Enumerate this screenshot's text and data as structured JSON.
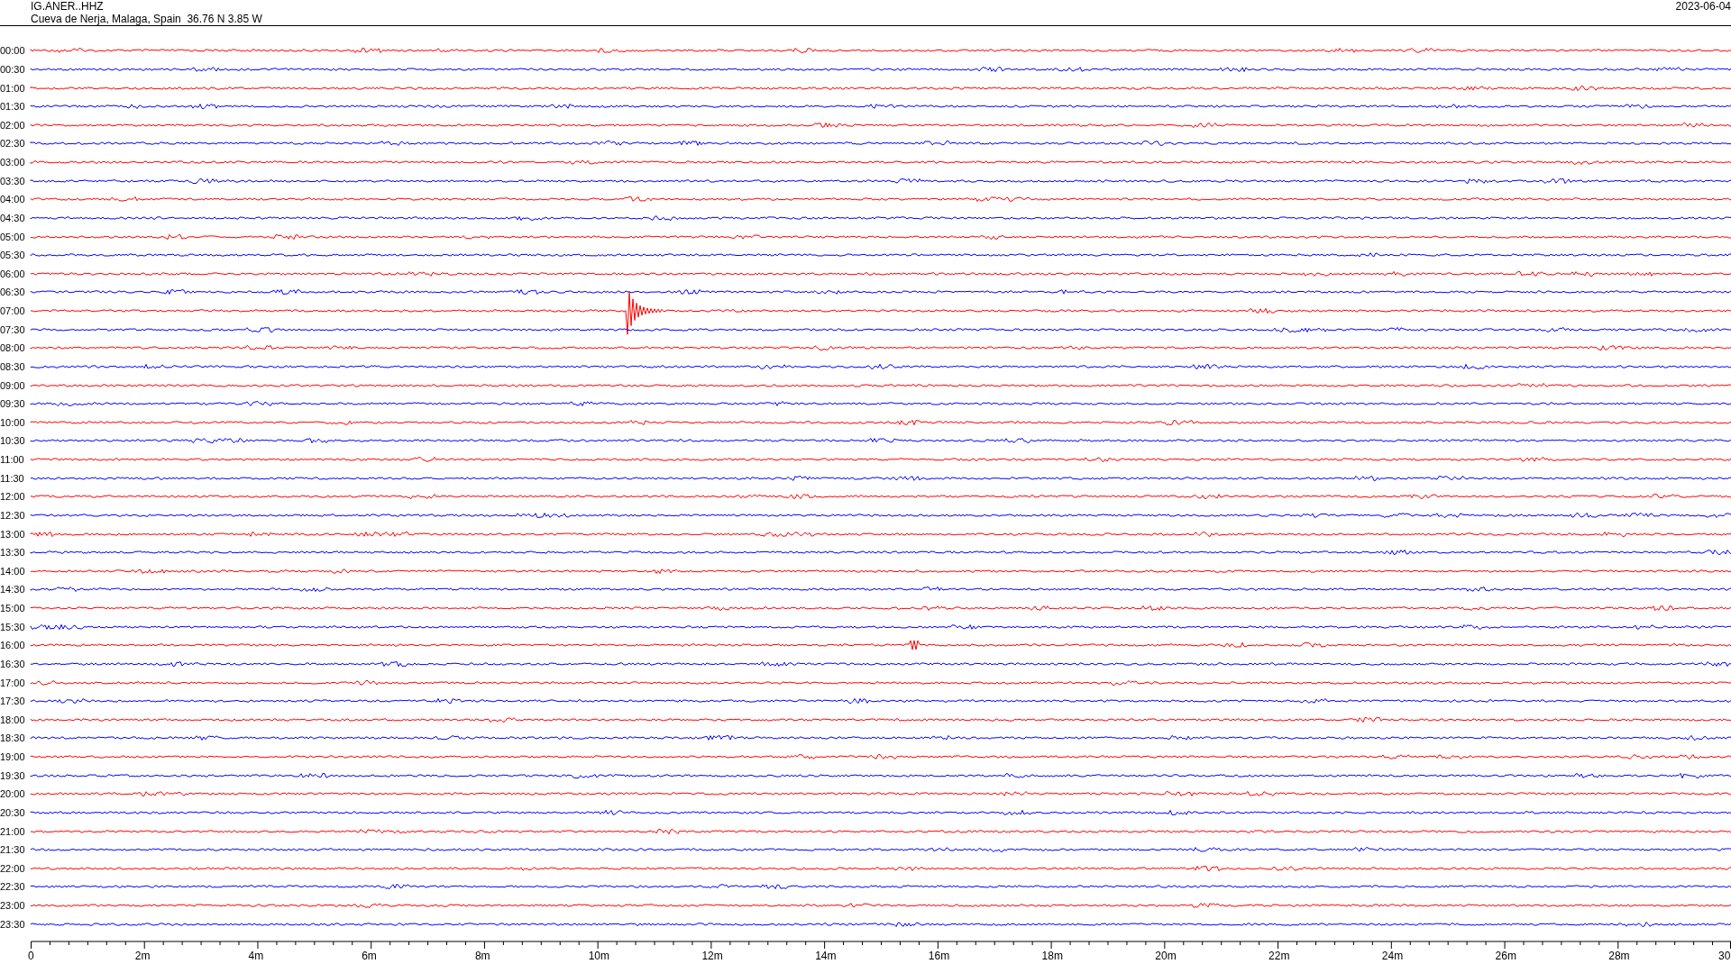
{
  "header": {
    "station": "IG.ANER..HHZ",
    "location": "Cueva de Nerja, Malaga, Spain  36.76 N 3.85 W",
    "date": "2023-06-04"
  },
  "rows": [
    {
      "label": "00:00",
      "color": "#ff0000"
    },
    {
      "label": "00:30",
      "color": "#0000ff"
    },
    {
      "label": "01:00",
      "color": "#ff0000"
    },
    {
      "label": "01:30",
      "color": "#0000ff"
    },
    {
      "label": "02:00",
      "color": "#ff0000"
    },
    {
      "label": "02:30",
      "color": "#0000ff"
    },
    {
      "label": "03:00",
      "color": "#ff0000"
    },
    {
      "label": "03:30",
      "color": "#0000ff"
    },
    {
      "label": "04:00",
      "color": "#ff0000"
    },
    {
      "label": "04:30",
      "color": "#0000ff"
    },
    {
      "label": "05:00",
      "color": "#ff0000"
    },
    {
      "label": "05:30",
      "color": "#0000ff"
    },
    {
      "label": "06:00",
      "color": "#ff0000"
    },
    {
      "label": "06:30",
      "color": "#0000ff"
    },
    {
      "label": "07:00",
      "color": "#ff0000"
    },
    {
      "label": "07:30",
      "color": "#0000ff"
    },
    {
      "label": "08:00",
      "color": "#ff0000"
    },
    {
      "label": "08:30",
      "color": "#0000ff"
    },
    {
      "label": "09:00",
      "color": "#ff0000"
    },
    {
      "label": "09:30",
      "color": "#0000ff"
    },
    {
      "label": "10:00",
      "color": "#ff0000"
    },
    {
      "label": "10:30",
      "color": "#0000ff"
    },
    {
      "label": "11:00",
      "color": "#ff0000"
    },
    {
      "label": "11:30",
      "color": "#0000ff"
    },
    {
      "label": "12:00",
      "color": "#ff0000"
    },
    {
      "label": "12:30",
      "color": "#0000ff"
    },
    {
      "label": "13:00",
      "color": "#ff0000"
    },
    {
      "label": "13:30",
      "color": "#0000ff"
    },
    {
      "label": "14:00",
      "color": "#ff0000"
    },
    {
      "label": "14:30",
      "color": "#0000ff"
    },
    {
      "label": "15:00",
      "color": "#ff0000"
    },
    {
      "label": "15:30",
      "color": "#0000ff"
    },
    {
      "label": "16:00",
      "color": "#ff0000"
    },
    {
      "label": "16:30",
      "color": "#0000ff"
    },
    {
      "label": "17:00",
      "color": "#ff0000"
    },
    {
      "label": "17:30",
      "color": "#0000ff"
    },
    {
      "label": "18:00",
      "color": "#ff0000"
    },
    {
      "label": "18:30",
      "color": "#0000ff"
    },
    {
      "label": "19:00",
      "color": "#ff0000"
    },
    {
      "label": "19:30",
      "color": "#0000ff"
    },
    {
      "label": "20:00",
      "color": "#ff0000"
    },
    {
      "label": "20:30",
      "color": "#0000ff"
    },
    {
      "label": "21:00",
      "color": "#ff0000"
    },
    {
      "label": "21:30",
      "color": "#0000ff"
    },
    {
      "label": "22:00",
      "color": "#ff0000"
    },
    {
      "label": "22:30",
      "color": "#0000ff"
    },
    {
      "label": "23:00",
      "color": "#ff0000"
    },
    {
      "label": "23:30",
      "color": "#0000ff"
    }
  ],
  "axis": {
    "ticks": [
      "0",
      "2m",
      "4m",
      "6m",
      "8m",
      "10m",
      "12m",
      "14m",
      "16m",
      "18m",
      "20m",
      "22m",
      "24m",
      "26m",
      "28m",
      "30"
    ]
  }
}
